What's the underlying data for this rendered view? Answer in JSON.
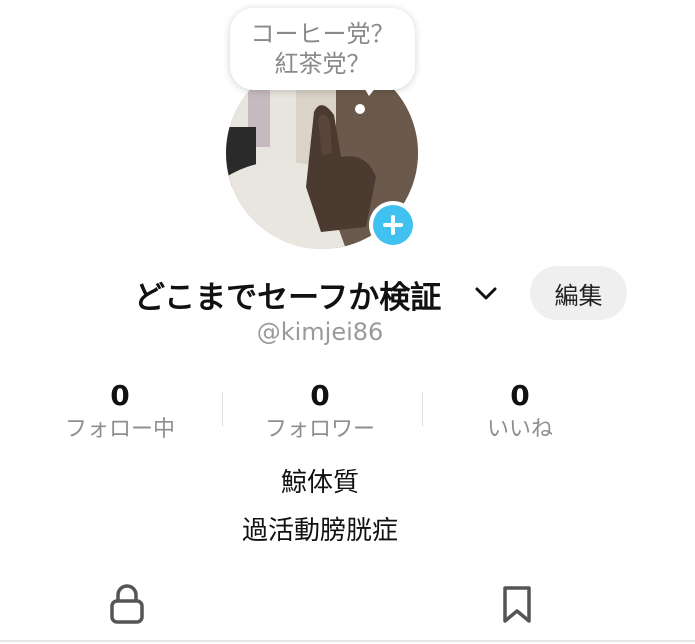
{
  "bubble": {
    "line1": "コーヒー党？",
    "line2": "紅茶党？"
  },
  "profile": {
    "display_name": "どこまでセーフか検証",
    "handle": "@kimjei86",
    "edit_label": "編集"
  },
  "stats": [
    {
      "value": "0",
      "label": "フォロー中"
    },
    {
      "value": "0",
      "label": "フォロワー"
    },
    {
      "value": "0",
      "label": "いいね"
    }
  ],
  "bio": {
    "line1": "鯨体質",
    "line2": "過活動膀胱症"
  },
  "colors": {
    "accent": "#40c1f0",
    "edit_bg": "#efefef",
    "muted": "#8f8f8f"
  },
  "icons": {
    "add": "plus-icon",
    "dropdown": "chevron-down-icon",
    "lock_tab": "lock-icon",
    "saved_tab": "bookmark-icon"
  }
}
